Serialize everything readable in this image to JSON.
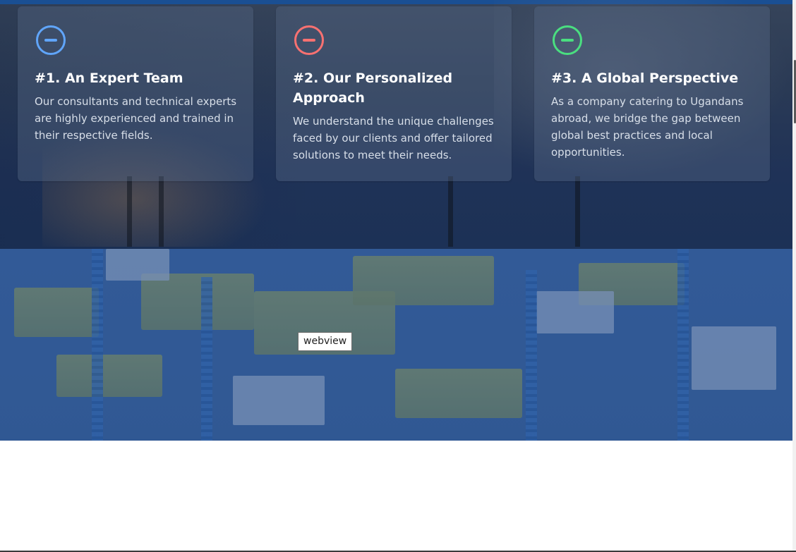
{
  "colors": {
    "accent_blue": "#60a5fa",
    "accent_red": "#f87171",
    "accent_green": "#4ade80",
    "section_background": "#1c3156"
  },
  "features": [
    {
      "icon": "minus-circle-icon",
      "title": "#1. An Expert Team",
      "text": "Our consultants and technical experts are highly experienced and trained in their respective fields."
    },
    {
      "icon": "minus-circle-icon",
      "title": "#2. Our Personalized Approach",
      "text": "We understand the unique challenges faced by our clients and offer tailored solutions to meet their needs."
    },
    {
      "icon": "minus-circle-icon",
      "title": "#3. A Global Perspective",
      "text": "As a company catering to Ugandans abroad, we bridge the gap between global best practices and local opportunities."
    }
  ],
  "webview": {
    "label": "webview"
  }
}
